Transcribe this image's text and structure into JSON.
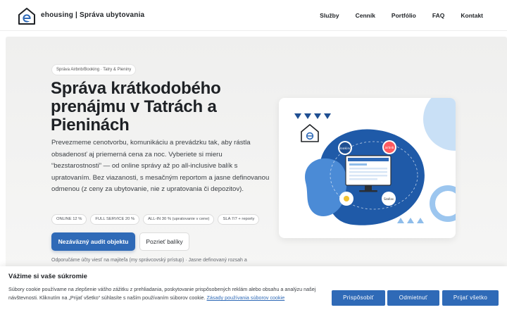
{
  "header": {
    "brand": "ehousing | Správa ubytovania",
    "logo_icon": "house-e-logo-icon",
    "nav": [
      {
        "label": "Služby"
      },
      {
        "label": "Cenník"
      },
      {
        "label": "Portfólio"
      },
      {
        "label": "FAQ"
      },
      {
        "label": "Kontakt"
      }
    ]
  },
  "hero": {
    "pill": "Správa Airbnb/Booking · Tatry & Pieniny",
    "title": "Správa krátkodobého prenájmu v Tatrách a Pieninách",
    "description": "Prevezmeme cenotvorbu, komunikáciu a prevádzku tak, aby rástla obsadenosť aj priemerná cena za noc. Vyberiete si mieru “bezstarostnosti” — od online správy až po all-inclusive balík s upratovaním. Bez viazanosti, s mesačným reportom a jasne definovanou odmenou (z ceny za ubytovanie, nie z upratovania či depozitov).",
    "chips": [
      "ONLINE 12 %",
      "FULL SERVICE 20 %",
      "ALL-IN 30 % (upratovanie v cene)",
      "SLA 7/7 + reporty"
    ],
    "primary_button": "Nezáväzný audit objektu",
    "secondary_button": "Pozrieť balíky",
    "note": "Odporučáme účty viesť na majiteľa (my správcovský prístup) · Jasne definovaný rozsah a"
  },
  "illustration": {
    "icons": [
      "booking-badge-icon",
      "airbnb-badge-icon",
      "monitor-dashboard-icon",
      "house-e-logo-icon"
    ],
    "badge_booking": "Booking",
    "badge_airbnb": "airbnb",
    "badge_other": "Szallas"
  },
  "cookie": {
    "title": "Vážime si vaše súkromie",
    "text": "Súbory cookie používame na zlepšenie vášho zážitku z prehliadania, poskytovanie prispôsobených reklám alebo obsahu a analýzu našej návštevnosti. Kliknutím na „Prijať všetko“ súhlasíte s naším používaním súborov cookie.",
    "link": "Zásady používania súborov cookie",
    "buttons": {
      "customize": "Prispôsobiť",
      "reject": "Odmietnuť",
      "accept": "Prijať všetko"
    }
  },
  "colors": {
    "accent": "#2f6ab7",
    "blob_dark": "#1f5aa8",
    "blob_light": "#4b8bd6"
  }
}
